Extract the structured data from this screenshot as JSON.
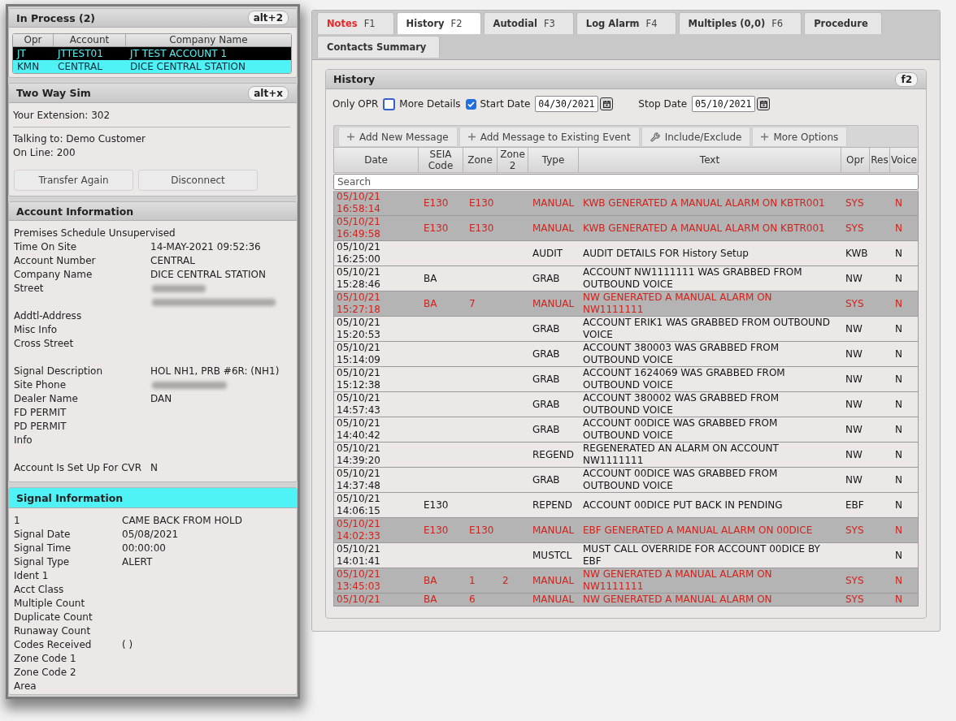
{
  "in_process": {
    "title": "In Process (2)",
    "shortcut": "alt+2",
    "columns": [
      "Opr",
      "Account",
      "Company Name"
    ],
    "rows": [
      {
        "opr": "JT",
        "account": "JTTEST01",
        "company_name": "JT TEST ACCOUNT 1",
        "selected": false
      },
      {
        "opr": "KMN",
        "account": "CENTRAL",
        "company_name": "DICE CENTRAL STATION",
        "selected": true
      }
    ]
  },
  "two_way_sim": {
    "title": "Two Way Sim",
    "shortcut": "alt+x",
    "extension": "Your Extension: 302",
    "talking_to": "Talking to: Demo Customer",
    "on_line": "On Line: 200",
    "buttons": [
      "Transfer Again",
      "Disconnect"
    ]
  },
  "account_information": {
    "title": "Account Information",
    "highlighted": false,
    "groups": [
      [
        {
          "kind": "note",
          "label": "Premises Schedule Unsupervised"
        },
        {
          "kind": "field",
          "label": "Time On Site",
          "value": "14-MAY-2021 09:52:36"
        },
        {
          "kind": "field",
          "label": "Account Number",
          "value": "CENTRAL"
        },
        {
          "kind": "field",
          "label": "Company Name",
          "value": "DICE CENTRAL STATION"
        },
        {
          "kind": "blurred_address",
          "label": "Street"
        },
        {
          "kind": "field",
          "label": "Addtl-Address"
        },
        {
          "kind": "field",
          "label": "Misc Info"
        },
        {
          "kind": "field",
          "label": "Cross Street"
        }
      ],
      [
        {
          "kind": "field",
          "label": "Signal Description",
          "value": "HOL NH1, PRB #6R: (NH1)"
        },
        {
          "kind": "blurred_phone",
          "label": "Site Phone"
        },
        {
          "kind": "field",
          "label": "Dealer Name",
          "value": "DAN"
        },
        {
          "kind": "field",
          "label": "FD PERMIT"
        },
        {
          "kind": "field",
          "label": "PD PERMIT"
        },
        {
          "kind": "field",
          "label": "Info"
        }
      ],
      [
        {
          "kind": "field",
          "label": "Account Is Set Up For CVR",
          "value": "N"
        }
      ]
    ]
  },
  "signal_information": {
    "title": "Signal Information",
    "highlighted": true,
    "fields": [
      {
        "label": "1",
        "value": "CAME BACK FROM HOLD"
      },
      {
        "label": "Signal Date",
        "value": "05/08/2021"
      },
      {
        "label": "Signal Time",
        "value": "00:00:00"
      },
      {
        "label": "Signal Type",
        "value": "ALERT"
      },
      {
        "label": "Ident 1"
      },
      {
        "label": "Acct Class"
      },
      {
        "label": "Multiple Count"
      },
      {
        "label": "Duplicate Count"
      },
      {
        "label": "Runaway Count"
      },
      {
        "label": "Codes Received",
        "value": "( )"
      },
      {
        "label": "Zone Code 1"
      },
      {
        "label": "Zone Code 2"
      },
      {
        "label": "Area"
      }
    ]
  },
  "tabs": [
    {
      "label": "Notes",
      "shortcut": "F1",
      "selected": false,
      "alert": true
    },
    {
      "label": "History",
      "shortcut": "F2",
      "selected": true,
      "alert": false
    },
    {
      "label": "Autodial",
      "shortcut": "F3",
      "selected": false,
      "alert": false
    },
    {
      "label": "Log Alarm",
      "shortcut": "F4",
      "selected": false,
      "alert": false
    },
    {
      "label": "Multiples (0,0)",
      "shortcut": "F6",
      "selected": false,
      "alert": false
    },
    {
      "label": "Procedure",
      "selected": false,
      "alert": false
    },
    {
      "label": "Contacts Summary",
      "selected": false,
      "alert": false
    }
  ],
  "history": {
    "title": "History",
    "shortcut": "f2",
    "filters": [
      {
        "kind": "checkbox",
        "label": "Only OPR",
        "checked": false
      },
      {
        "kind": "checkbox",
        "label": "More Details",
        "checked": true
      },
      {
        "kind": "date",
        "label": "Start Date",
        "value": "04/30/2021"
      },
      {
        "kind": "date",
        "label": "Stop Date",
        "value": "05/10/2021"
      }
    ],
    "toolbar": [
      {
        "kind": "add",
        "label": "Add New Message"
      },
      {
        "kind": "add",
        "label": "Add Message to Existing Event"
      },
      {
        "kind": "tool",
        "label": "Include/Exclude"
      },
      {
        "kind": "add",
        "label": "More Options"
      }
    ],
    "columns": [
      "Date",
      "SEIA Code",
      "Zone",
      "Zone 2",
      "Type",
      "Text",
      "Opr",
      "Res",
      "Voice"
    ],
    "search": {
      "placeholder": "Search"
    },
    "rows": [
      {
        "date": "05/10/21 16:58:14",
        "seia_code": "E130",
        "zone": "E130",
        "type": "MANUAL",
        "text": "KWB GENERATED A MANUAL ALARM ON KBTR001",
        "opr": "SYS",
        "voice": "N",
        "alarm": true
      },
      {
        "date": "05/10/21 16:49:58",
        "seia_code": "E130",
        "zone": "E130",
        "type": "MANUAL",
        "text": "KWB GENERATED A MANUAL ALARM ON KBTR001",
        "opr": "SYS",
        "voice": "N",
        "alarm": true
      },
      {
        "date": "05/10/21 16:25:00",
        "type": "AUDIT",
        "text": "AUDIT DETAILS FOR History Setup",
        "opr": "KWB",
        "voice": "N",
        "alarm": false
      },
      {
        "date": "05/10/21 15:28:46",
        "seia_code": "BA",
        "type": "GRAB",
        "text": "ACCOUNT NW1111111 WAS GRABBED FROM OUTBOUND VOICE",
        "opr": "NW",
        "voice": "N",
        "alarm": false
      },
      {
        "date": "05/10/21 15:27:18",
        "seia_code": "BA",
        "zone": "7",
        "type": "MANUAL",
        "text": "NW GENERATED A MANUAL ALARM ON NW1111111",
        "opr": "SYS",
        "voice": "N",
        "alarm": true
      },
      {
        "date": "05/10/21 15:20:53",
        "type": "GRAB",
        "text": "ACCOUNT ERIK1 WAS GRABBED FROM OUTBOUND VOICE",
        "opr": "NW",
        "voice": "N",
        "alarm": false
      },
      {
        "date": "05/10/21 15:14:09",
        "type": "GRAB",
        "text": "ACCOUNT 380003 WAS GRABBED FROM OUTBOUND VOICE",
        "opr": "NW",
        "voice": "N",
        "alarm": false
      },
      {
        "date": "05/10/21 15:12:38",
        "type": "GRAB",
        "text": "ACCOUNT 1624069 WAS GRABBED FROM OUTBOUND VOICE",
        "opr": "NW",
        "voice": "N",
        "alarm": false
      },
      {
        "date": "05/10/21 14:57:43",
        "type": "GRAB",
        "text": "ACCOUNT 380002 WAS GRABBED FROM OUTBOUND VOICE",
        "opr": "NW",
        "voice": "N",
        "alarm": false
      },
      {
        "date": "05/10/21 14:40:42",
        "type": "GRAB",
        "text": "ACCOUNT 00DICE WAS GRABBED FROM OUTBOUND VOICE",
        "opr": "NW",
        "voice": "N",
        "alarm": false
      },
      {
        "date": "05/10/21 14:39:20",
        "type": "REGEND",
        "text": "REGENERATED AN ALARM ON ACCOUNT NW1111111",
        "opr": "NW",
        "voice": "N",
        "alarm": false
      },
      {
        "date": "05/10/21 14:37:48",
        "type": "GRAB",
        "text": "ACCOUNT 00DICE WAS GRABBED FROM OUTBOUND VOICE",
        "opr": "NW",
        "voice": "N",
        "alarm": false
      },
      {
        "date": "05/10/21 14:06:15",
        "seia_code": "E130",
        "type": "REPEND",
        "text": "ACCOUNT 00DICE PUT BACK IN PENDING",
        "opr": "EBF",
        "voice": "N",
        "alarm": false
      },
      {
        "date": "05/10/21 14:02:33",
        "seia_code": "E130",
        "zone": "E130",
        "type": "MANUAL",
        "text": "EBF GENERATED A MANUAL ALARM ON 00DICE",
        "opr": "SYS",
        "voice": "N",
        "alarm": true
      },
      {
        "date": "05/10/21 14:01:41",
        "type": "MUSTCL",
        "text": "MUST CALL OVERRIDE FOR ACCOUNT 00DICE BY EBF",
        "voice": "N",
        "alarm": false
      },
      {
        "date": "05/10/21 13:45:03",
        "seia_code": "BA",
        "zone": "1",
        "zone_2": "2",
        "type": "MANUAL",
        "text": "NW GENERATED A MANUAL ALARM ON NW1111111",
        "opr": "SYS",
        "voice": "N",
        "alarm": true
      },
      {
        "date": "05/10/21",
        "seia_code": "BA",
        "zone": "6",
        "type": "MANUAL",
        "text": "NW GENERATED A MANUAL ALARM ON",
        "opr": "SYS",
        "voice": "N",
        "alarm": true
      }
    ]
  }
}
